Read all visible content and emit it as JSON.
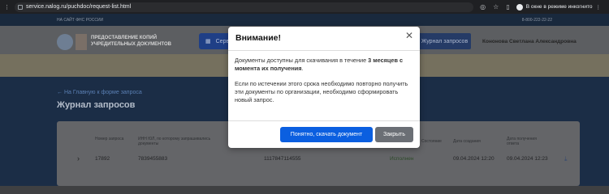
{
  "browser": {
    "url": "service.nalog.ru/puchdoc/request-list.html",
    "incognito_label": "В окне в режиме инкогнито"
  },
  "site": {
    "top_link": "НА САЙТ ФНС РОССИИ",
    "phone": "8-800-222-22-22",
    "brand_line1": "ПРЕДОСТАВЛЕНИЕ КОПИЙ",
    "brand_line2": "УЧРЕДИТЕЛЬНЫХ ДОКУМЕНТОВ",
    "services_label": "Серв",
    "requests_tab": "Журнал запросов",
    "user_name": "Кононова Светлана Александровна",
    "back_link": "← На Главную к форме запроса",
    "page_title": "Журнал запросов"
  },
  "table": {
    "headers": {
      "number": "Номер запроса",
      "inn": "ИНН ЮЛ, по которому запрашивались документы",
      "status": "Состояние",
      "created": "Дата создания",
      "received": "Дата получения ответа"
    },
    "row": {
      "number": "17892",
      "inn": "7839455883",
      "ogrn": "1117847114555",
      "status": "Исполнен",
      "created": "09.04.2024 12:20",
      "received": "09.04.2024 12:23"
    }
  },
  "modal": {
    "title": "Внимание!",
    "p1_before": "Документы доступны для скачивания в течение ",
    "p1_bold": "3 месяцев с момента их получения",
    "p1_after": ".",
    "p2": "Если по истечении этого срока необходимо повторно получить эти документы по организации, необходимо сформировать новый запрос.",
    "primary_button": "Понятно, скачать документ",
    "secondary_button": "Закрыть"
  }
}
